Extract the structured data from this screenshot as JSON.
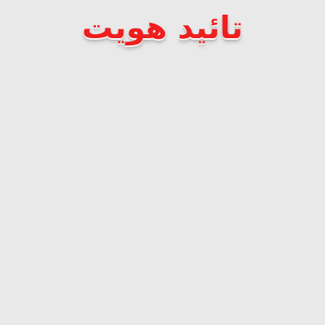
{
  "header": {
    "title": "تائید هویت"
  },
  "colors": {
    "background": "#e9e9e9",
    "title": "#ee1f1f"
  }
}
